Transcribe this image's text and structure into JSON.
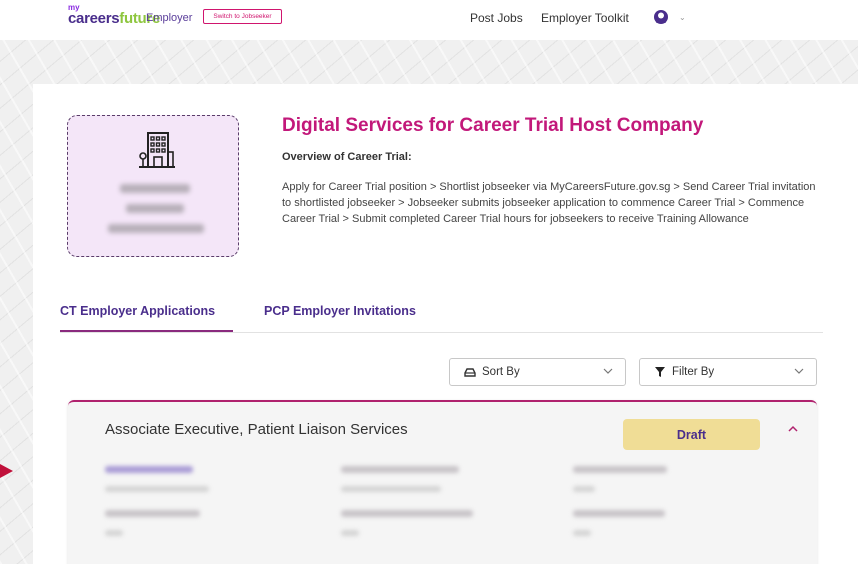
{
  "nav": {
    "logo_my": "my",
    "logo_careers": "careers",
    "logo_future": "future",
    "employer_label": "Employer",
    "switch_label": "Switch to Jobseeker",
    "links": [
      "Post Jobs",
      "Employer Toolkit"
    ],
    "avatar_icon": "user-avatar-icon",
    "chevron_icon": "chevron-down-icon"
  },
  "company": {
    "logo_icon": "building-icon",
    "title": "Digital Services for Career Trial Host Company",
    "overview_title": "Overview of Career Trial:",
    "overview_text": "Apply for Career Trial position > Shortlist jobseeker via MyCareersFuture.gov.sg > Send Career Trial invitation to shortlisted jobseeker > Jobseeker submits jobseeker application to commence Career Trial > Commence Career Trial > Submit completed Career Trial hours for jobseekers to receive Training Allowance"
  },
  "tabs": [
    {
      "label": "CT Employer Applications",
      "active": true
    },
    {
      "label": "PCP Employer Invitations",
      "active": false
    }
  ],
  "controls": {
    "sort_label": "Sort By",
    "sort_icon": "sort-icon",
    "filter_label": "Filter By",
    "filter_icon": "filter-icon"
  },
  "application": {
    "title": "Associate Executive, Patient Liaison Services",
    "status": "Draft",
    "collapse_icon": "chevron-up-icon"
  },
  "colors": {
    "brand_purple": "#4a2e8c",
    "accent_magenta": "#c2187a",
    "draft_badge": "#f0dd96",
    "card_border": "#b0226e",
    "logo_box_bg": "#f4e6f8"
  }
}
